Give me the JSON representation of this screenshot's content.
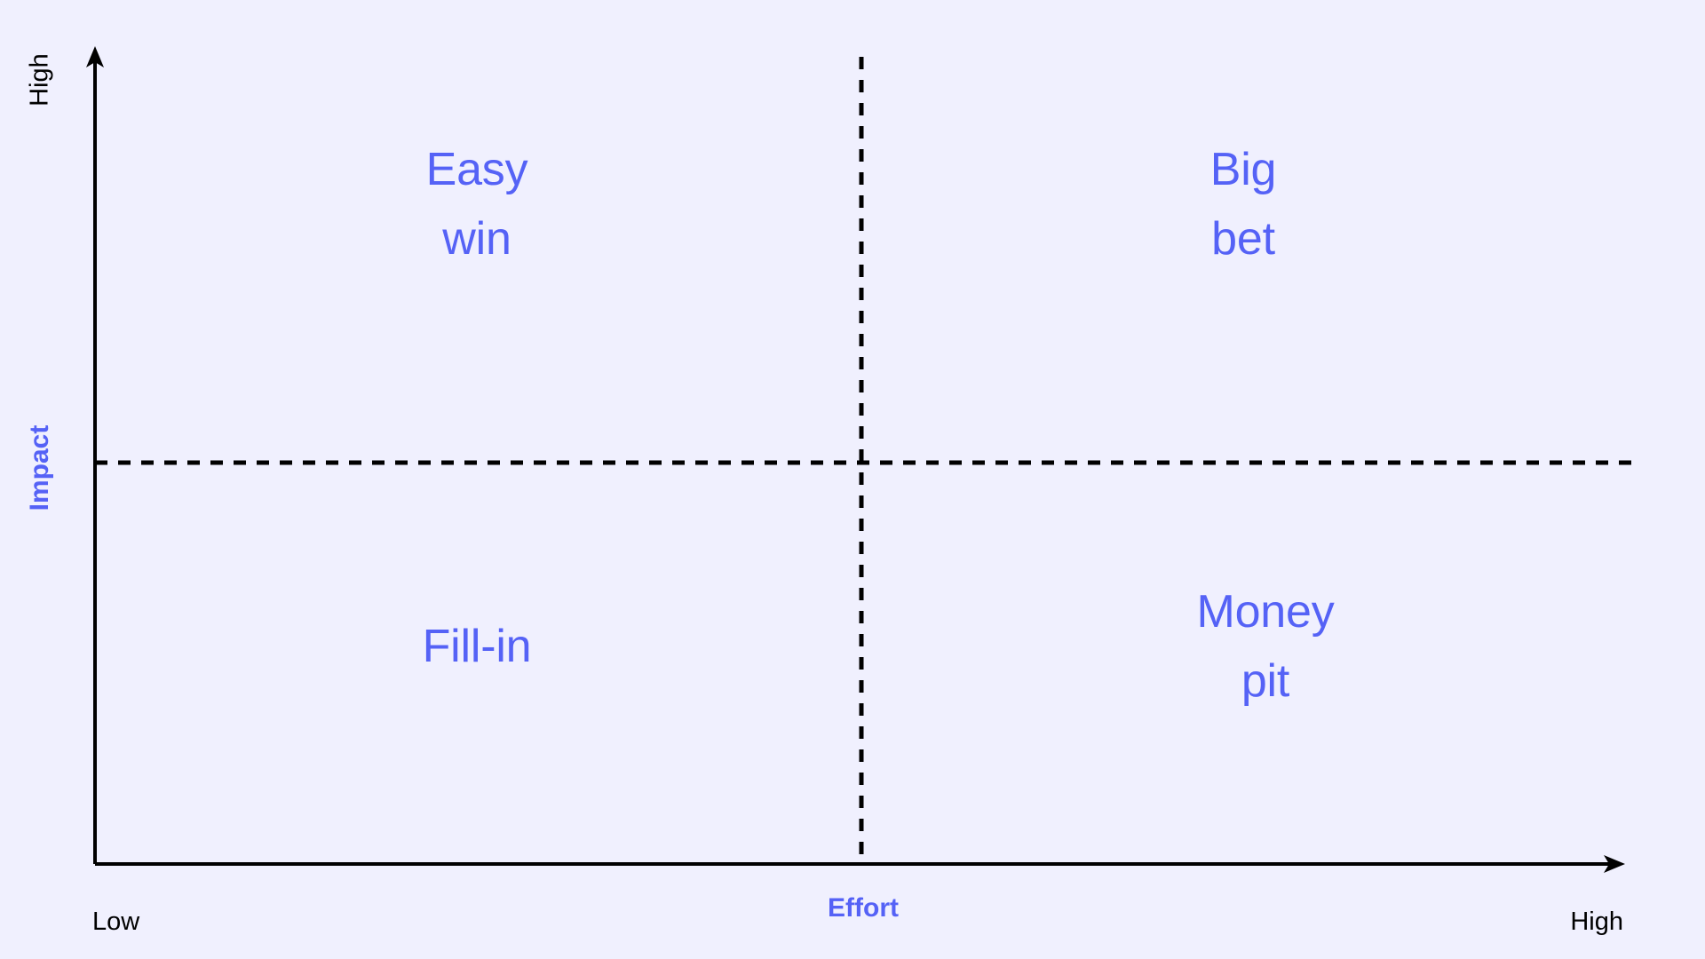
{
  "chart_data": {
    "type": "scatter",
    "title": "",
    "xlabel": "Effort",
    "ylabel": "Impact",
    "x_tick_labels": [
      "Low",
      "High"
    ],
    "y_tick_labels": [
      "High"
    ],
    "grid": false,
    "legend": "none",
    "xlim": [
      "Low",
      "High"
    ],
    "ylim": [
      "",
      "High"
    ],
    "quadrants": [
      {
        "id": "easy-win",
        "label": "Easy\nwin",
        "effort": "Low",
        "impact": "High",
        "position": "top-left"
      },
      {
        "id": "big-bet",
        "label": "Big\nbet",
        "effort": "High",
        "impact": "High",
        "position": "top-right"
      },
      {
        "id": "fill-in",
        "label": "Fill-in",
        "effort": "Low",
        "impact": "Low",
        "position": "bottom-left"
      },
      {
        "id": "money-pit",
        "label": "Money\npit",
        "effort": "High",
        "impact": "Low",
        "position": "bottom-right"
      }
    ],
    "dividers": [
      {
        "orientation": "vertical",
        "style": "dashed"
      },
      {
        "orientation": "horizontal",
        "style": "dashed"
      }
    ],
    "series": []
  },
  "colors": {
    "background": "#f0f0fe",
    "accent": "#5562f6",
    "axis": "#000000",
    "divider": "#000000"
  },
  "axes": {
    "y": {
      "title": "Impact",
      "high_label": "High"
    },
    "x": {
      "title": "Effort",
      "low_label": "Low",
      "high_label": "High"
    }
  },
  "quadrant_labels": {
    "easy_win": "Easy\nwin",
    "big_bet": "Big\nbet",
    "fill_in": "Fill-in",
    "money_pit": "Money\npit"
  }
}
